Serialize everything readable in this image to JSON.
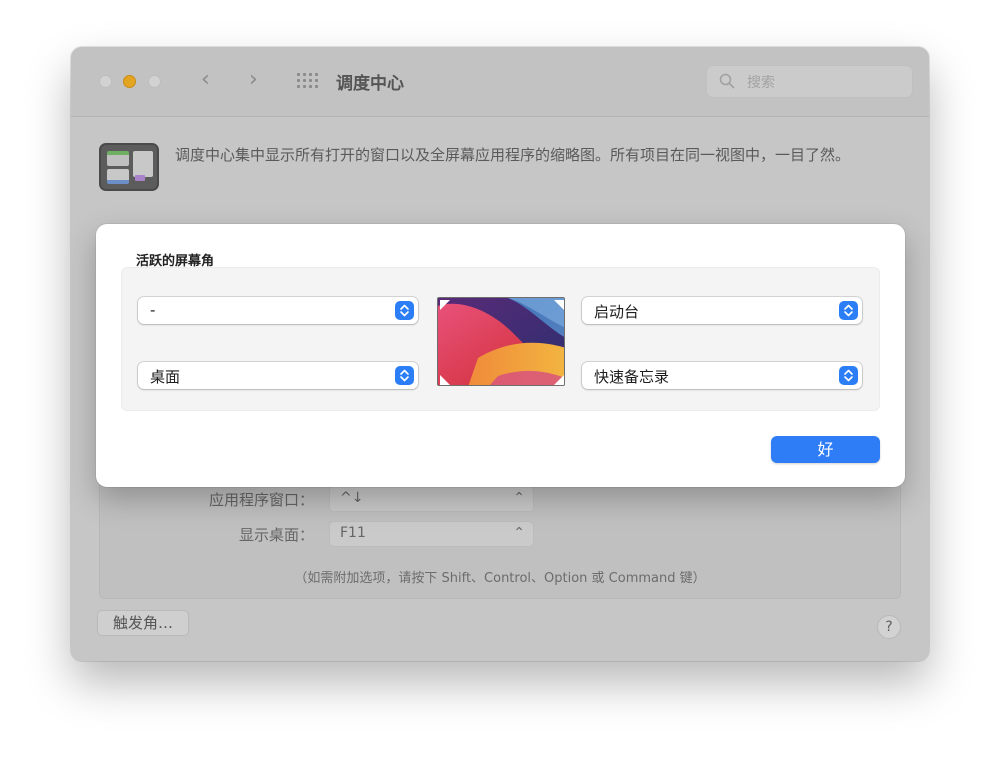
{
  "window": {
    "title": "调度中心",
    "search": {
      "placeholder": "搜索"
    },
    "description": "调度中心集中显示所有打开的窗口以及全屏幕应用程序的缩略图。所有项目在同一视图中，一目了然。",
    "keyboard": {
      "app_windows_label": "应用程序窗口：",
      "app_windows_value": "^↓",
      "show_desktop_label": "显示桌面：",
      "show_desktop_value": "F11",
      "hint": "（如需附加选项，请按下 Shift、Control、Option 或 Command 键）"
    },
    "hot_corners_button": "触发角…",
    "help_button": "?"
  },
  "sheet": {
    "title": "活跃的屏幕角",
    "top_left": "-",
    "top_right": "启动台",
    "bottom_left": "桌面",
    "bottom_right": "快速备忘录",
    "ok_label": "好"
  },
  "colors": {
    "accent": "#2f7df6",
    "minimize_yellow": "#e3a422"
  },
  "icons": [
    "back-chevron-icon",
    "forward-chevron-icon",
    "app-grid-icon",
    "search-icon",
    "mission-control-icon",
    "popup-arrows-icon"
  ]
}
